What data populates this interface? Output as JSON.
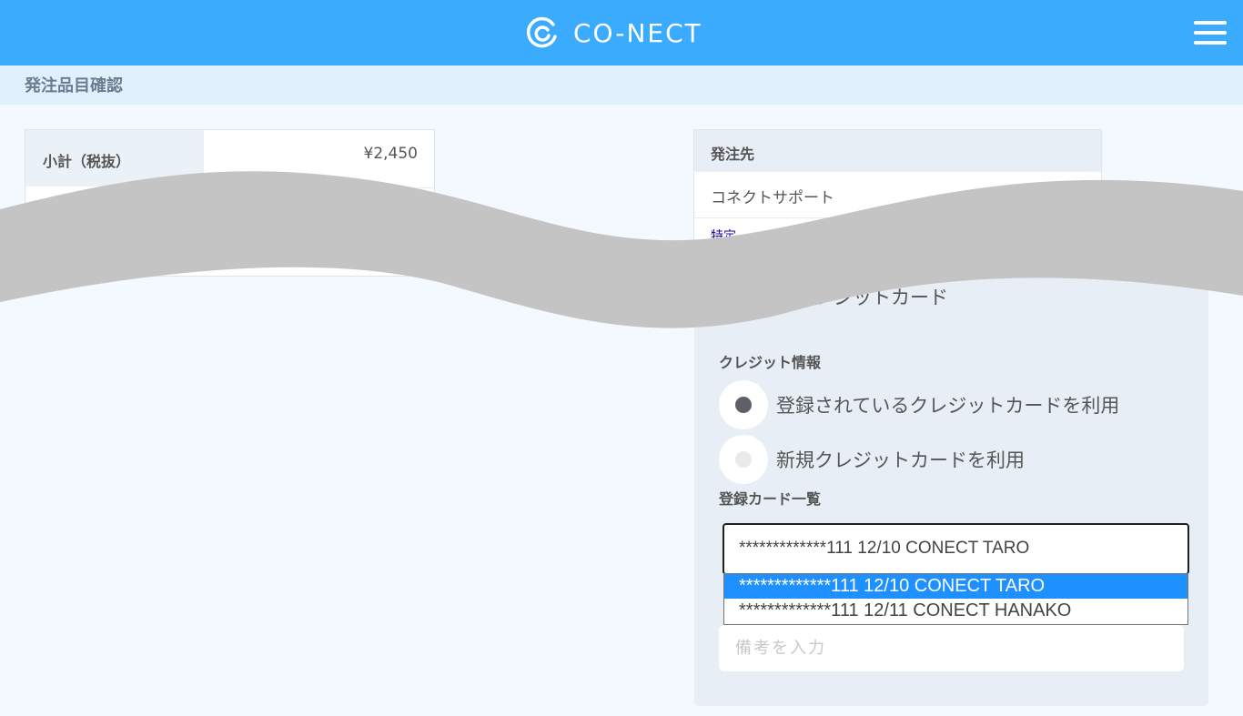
{
  "header": {
    "logo_text": "CO-NECT",
    "brand_color": "#3aabfd"
  },
  "section": {
    "title": "発注品目確認"
  },
  "summary": {
    "subtotal_label": "小計（税抜）",
    "subtotal_value": "¥2,450"
  },
  "destination": {
    "title": "発注先",
    "name": "コネクトサポート",
    "link_fragment": "特定"
  },
  "payment": {
    "method_text": "レジットカード",
    "credit_info_title": "クレジット情報",
    "options": [
      {
        "label": "登録されているクレジットカードを利用",
        "checked": true
      },
      {
        "label": "新規クレジットカードを利用",
        "checked": false
      }
    ],
    "cards_title": "登録カード一覧",
    "selected_card": "*************111 12/10 CONECT TARO",
    "card_options": [
      {
        "label": "*************111 12/10 CONECT TARO",
        "highlighted": true
      },
      {
        "label": "*************111 12/11 CONECT HANAKO",
        "highlighted": false
      }
    ],
    "memo_placeholder": "備考を入力"
  }
}
